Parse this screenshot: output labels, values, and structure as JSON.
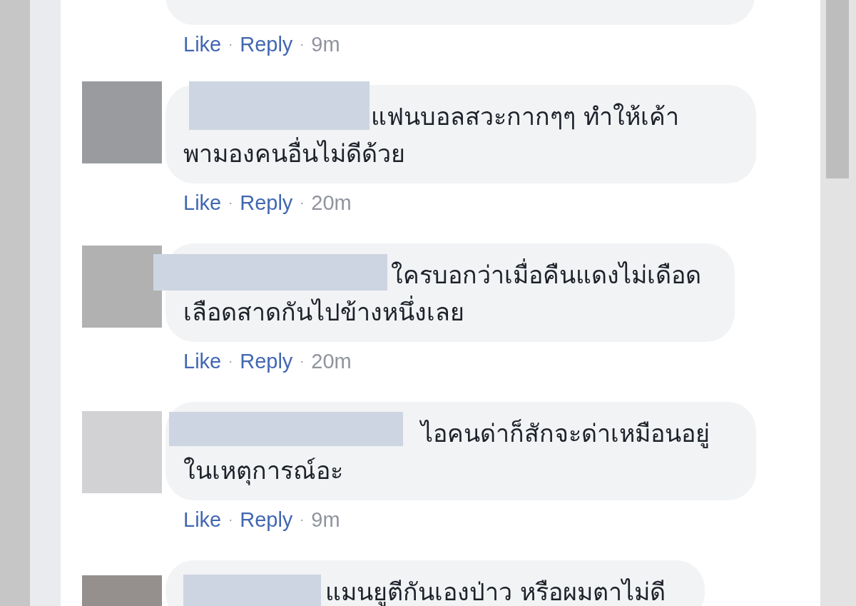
{
  "top_comment": {
    "actions": {
      "like": "Like",
      "separator_1": "·",
      "reply": "Reply",
      "separator_2": "·",
      "time": "9m"
    }
  },
  "comments": [
    {
      "color": "#9a9b9f",
      "lines": [
        "แฟนบอลสวะกากๆๆ ทำให้เค้า",
        "พามองคนอื่นไม่ดีด้วย"
      ],
      "actions": {
        "like": "Like",
        "separator_1": "·",
        "reply": "Reply",
        "separator_2": "·",
        "time": "20m"
      }
    },
    {
      "color": "#b1b1b1",
      "lines": [
        "ใครบอกว่าเมื่อคืนแดงไม่เดือด",
        "เลือดสาดกันไปข้างหนึ่งเลย"
      ],
      "actions": {
        "like": "Like",
        "separator_1": "·",
        "reply": "Reply",
        "separator_2": "·",
        "time": "20m"
      }
    },
    {
      "color": "#d2d2d4",
      "lines": [
        "ไอคนด่าก็สักจะด่าเหมือนอยู่",
        "ในเหตุการณ์อะ"
      ],
      "actions": {
        "like": "Like",
        "separator_1": "·",
        "reply": "Reply",
        "separator_2": "·",
        "time": "9m"
      }
    },
    {
      "color": "#958f8e",
      "lines": [
        "แมนยูตีกันเองป่าว หรือผมตาไม่ดี"
      ]
    }
  ]
}
